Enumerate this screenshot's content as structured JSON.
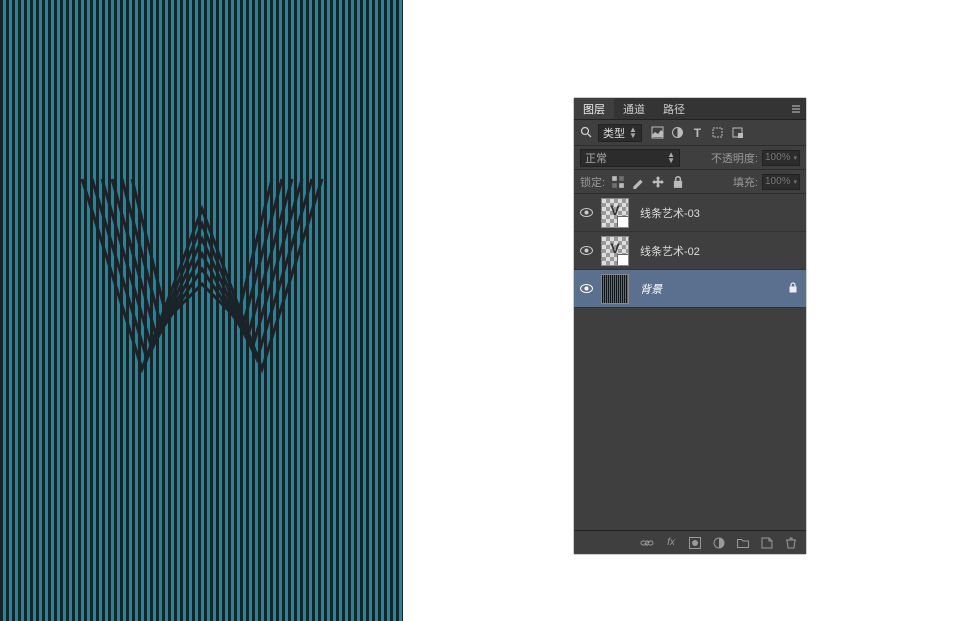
{
  "tabs": {
    "layers": "图层",
    "channels": "通道",
    "paths": "路径"
  },
  "filter": {
    "type_label": "类型"
  },
  "blend": {
    "mode": "正常",
    "opacity_label": "不透明度:",
    "opacity_value": "100%"
  },
  "lock": {
    "label": "锁定:",
    "fill_label": "填充:",
    "fill_value": "100%"
  },
  "layers": [
    {
      "name": "线条艺术-03",
      "selected": false,
      "locked": false,
      "thumb": "smart-v"
    },
    {
      "name": "线条艺术-02",
      "selected": false,
      "locked": false,
      "thumb": "smart-v"
    },
    {
      "name": "背景",
      "selected": true,
      "locked": true,
      "thumb": "stripes",
      "italic": true
    }
  ],
  "icon_names": {
    "search": "search-icon",
    "image_filter": "image-filter-icon",
    "adjustment_filter": "adjustment-filter-icon",
    "text_filter": "text-filter-icon",
    "shape_filter": "shape-filter-icon",
    "smart_filter": "smart-filter-icon",
    "lock_pixels": "lock-pixels-icon",
    "lock_paint": "lock-paint-icon",
    "lock_move": "lock-move-icon",
    "lock_all": "lock-all-icon",
    "link": "link-icon",
    "fx": "fx-icon",
    "mask": "mask-icon",
    "adjustment": "adjustment-icon",
    "group": "group-icon",
    "new_layer": "new-layer-icon",
    "trash": "trash-icon"
  }
}
